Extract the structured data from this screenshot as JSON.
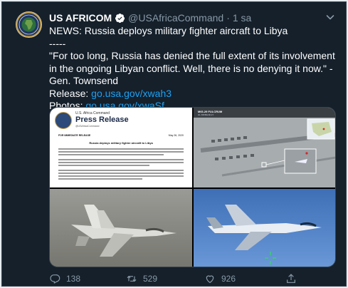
{
  "tweet": {
    "author": {
      "name": "US AFRICOM",
      "handle": "@USAfricaCommand",
      "separator": "·",
      "timestamp": "1 sa"
    },
    "text": {
      "headline": "NEWS: Russia deploys military fighter aircraft to Libya",
      "divider": "-----",
      "quote": "\"For too long, Russia has denied the full extent of its involvement in the ongoing Libyan conflict. Well, there is no denying it now.\" - Gen. Townsend",
      "release_label": "Release:",
      "release_link": "go.usa.gov/xwah3",
      "photos_label": "Photos:",
      "photos_link": "go.usa.gov/xwaSf"
    },
    "media": {
      "press_release": {
        "org": "U.S. Africa Command",
        "title": "Press Release",
        "handle": "@USAfricaCommand",
        "release": "FOR IMMEDIATE RELEASE",
        "date": "May 26, 2020",
        "headline": "Russia deploys military fighter aircraft to Libya"
      },
      "satellite": {
        "title": "MIG-29 FULCRUM",
        "subtitle": "AL JUFRA AF,LY"
      }
    },
    "actions": {
      "replies": "138",
      "retweets": "529",
      "likes": "926"
    },
    "colors": {
      "background": "#15202b",
      "link": "#1da1f2",
      "muted": "#8899a6",
      "verified": "#1da1f2"
    }
  }
}
